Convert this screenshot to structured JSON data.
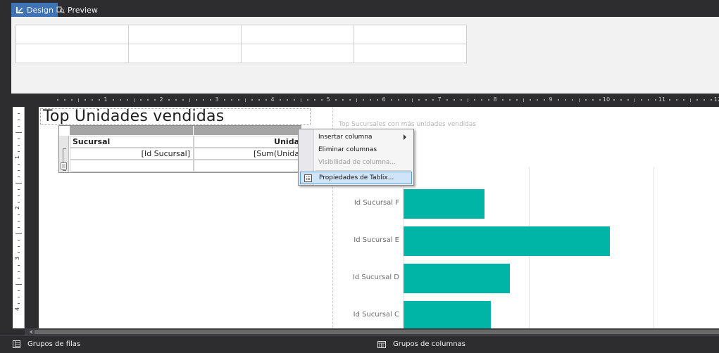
{
  "tabs": [
    {
      "label": "Design",
      "icon": "design-icon",
      "active": true
    },
    {
      "label": "Preview",
      "icon": "preview-icon",
      "active": false
    }
  ],
  "ruler": {
    "horizontal_numbers": [
      "1",
      "2",
      "3",
      "4",
      "5",
      "6",
      "7",
      "8",
      "9",
      "10",
      "11",
      "12"
    ],
    "vertical_numbers": [
      "1",
      "2",
      "3",
      "4"
    ]
  },
  "report": {
    "title": "Top Unidades vendidas"
  },
  "tablix": {
    "headers": [
      "Sucursal",
      "Unida"
    ],
    "cells": [
      "[Id Sucursal]",
      "[Sum(Unida"
    ]
  },
  "chart": {
    "title": "Top Sucursales con más unidades vendidas",
    "bar_color": "#00b5a5"
  },
  "chart_data": {
    "type": "bar",
    "orientation": "horizontal",
    "title": "Top Sucursales con más unidades vendidas",
    "categories": [
      "Id Sucursal F",
      "Id Sucursal E",
      "Id Sucursal D",
      "Id Sucursal C"
    ],
    "values": [
      0.65,
      1.65,
      0.85,
      0.7
    ],
    "xlim": [
      0,
      2
    ],
    "grid": true
  },
  "context_menu": {
    "items": [
      {
        "label": "Insertar columna",
        "submenu": true,
        "enabled": true
      },
      {
        "label": "Eliminar columnas",
        "submenu": false,
        "enabled": true
      },
      {
        "label": "Visibilidad de columna...",
        "submenu": false,
        "enabled": false
      },
      {
        "label": "Propiedades de Tablix...",
        "submenu": false,
        "enabled": true,
        "highlighted": true
      }
    ]
  },
  "status_bar": {
    "row_groups_label": "Grupos de filas",
    "column_groups_label": "Grupos de columnas"
  }
}
